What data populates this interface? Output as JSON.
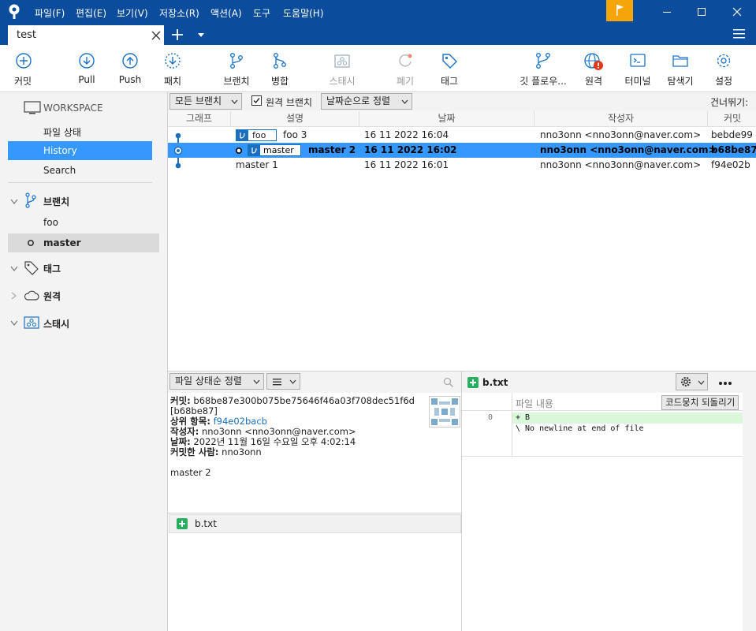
{
  "menu": [
    "파일(F)",
    "편집(E)",
    "보기(V)",
    "저장소(R)",
    "액션(A)",
    "도구",
    "도움말(H)"
  ],
  "tab": {
    "label": "test"
  },
  "toolbar": {
    "commit": "커밋",
    "pull": "Pull",
    "push": "Push",
    "patch": "패치",
    "branch": "브랜치",
    "merge": "병합",
    "stash": "스태시",
    "discard": "폐기",
    "tag": "태그",
    "gitflow": "깃 플로우...",
    "remote": "원격",
    "terminal": "터미널",
    "explorer": "탐색기",
    "settings": "설정"
  },
  "sidebar": {
    "workspace": "WORKSPACE",
    "file_status": "파일 상태",
    "history": "History",
    "search": "Search",
    "branches_header": "브랜치",
    "branches": [
      "foo",
      "master"
    ],
    "tags_header": "태그",
    "remotes_header": "원격",
    "stash_header": "스태시"
  },
  "filterbar": {
    "branches_select": "모든 브랜치",
    "remote_branches_label": "원격 브랜치",
    "remote_branches_checked": true,
    "sort_select": "날짜순으로 정렬",
    "skip_label": "건너뛰기:"
  },
  "grid": {
    "headers": [
      "그래프",
      "설명",
      "날짜",
      "작성자",
      "커밋"
    ],
    "rows": [
      {
        "branch": "foo",
        "message": "foo 3",
        "date": "16 11 2022 16:04",
        "author": "nno3onn <nno3onn@naver.com>",
        "hash": "bebde99"
      },
      {
        "branch": "master",
        "message": "master 2",
        "date": "16 11 2022 16:02",
        "author": "nno3onn <nno3onn@naver.com>",
        "hash": "b68be87"
      },
      {
        "branch": "",
        "message": "master 1",
        "date": "16 11 2022 16:01",
        "author": "nno3onn <nno3onn@naver.com>",
        "hash": "f94e02b"
      }
    ]
  },
  "details": {
    "sort_select": "파일 상태순 정렬",
    "commit_label": "커밋:",
    "commit_hash": "b68be87e300b075be75646f46a03f708dec51f6d",
    "commit_short": "[b68be87]",
    "parent_label": "상위 항목:",
    "parent_hash": "f94e02bacb",
    "author_label": "작성자:",
    "author": "nno3onn <nno3onn@naver.com>",
    "date_label": "날짜:",
    "date": "2022년 11월 16일 수요일 오후 4:02:14",
    "committer_label": "커밋한 사람:",
    "committer": "nno3onn",
    "message": "master 2",
    "files": [
      "b.txt"
    ]
  },
  "diff": {
    "filename": "b.txt",
    "revert_button": "코드뭉치 되돌리기",
    "content_header": "파일 내용",
    "line_number": "0",
    "lines": [
      "+ B",
      "\\ No newline at end of file"
    ]
  },
  "colors": {
    "titlebar": "#0b4d9c",
    "selection": "#3498ff",
    "flag": "#f5a50a",
    "added": "#27ae60"
  }
}
